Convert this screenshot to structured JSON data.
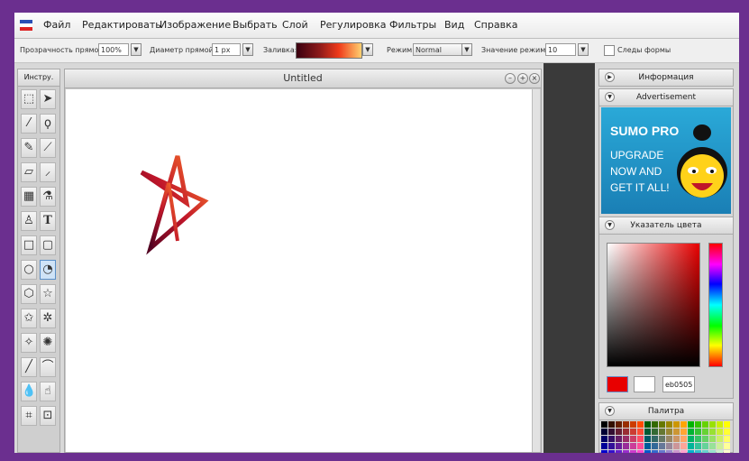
{
  "menu": {
    "items": [
      "Файл",
      "Редактировать",
      "Изображение",
      "Выбрать",
      "Слой",
      "Регулировка",
      "Фильтры",
      "Вид",
      "Справка"
    ]
  },
  "options": {
    "opacity_label": "Прозрачность прямой:",
    "opacity_value": "100%",
    "diameter_label": "Диаметр прямой:",
    "diameter_value": "1 px",
    "fill_label": "Заливка:",
    "mode_label": "Режим:",
    "mode_value": "Normal",
    "mode_value_label": "Значение режима:",
    "mode_value_value": "10",
    "shape_trail_label": "Следы формы"
  },
  "toolbox": {
    "title": "Инстру."
  },
  "canvas": {
    "title": "Untitled"
  },
  "panels": {
    "info_title": "Информация",
    "ad_title": "Advertisement",
    "ad": {
      "brand": "SUMO PRO",
      "line1": "UPGRADE",
      "line2": "NOW AND",
      "line3": "GET IT ALL!"
    },
    "color_title": "Указатель цвета",
    "color_hex": "eb0505",
    "palette_title": "Палитра"
  },
  "colors": {
    "primary": "#e80000",
    "secondary": "#ffffff",
    "frame": "#6b2f8f"
  }
}
